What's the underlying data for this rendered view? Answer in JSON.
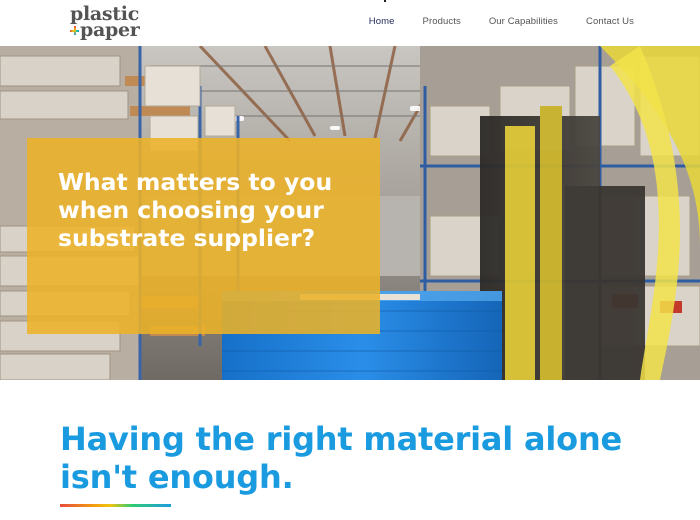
{
  "brand": {
    "line1": "plastic",
    "line2": "paper"
  },
  "nav": {
    "items": [
      {
        "label": "Home"
      },
      {
        "label": "Products"
      },
      {
        "label": "Our Capabilities"
      },
      {
        "label": "Contact Us"
      }
    ],
    "active": "Home"
  },
  "hero": {
    "title": "What matters to you when choosing your substrate supplier?",
    "overlay_color": "#ecb228",
    "image_subject": "warehouse-forklift"
  },
  "section": {
    "headline": "Having the right material alone isn't enough.",
    "headline_color": "#1a9be0"
  },
  "colors": {
    "nav_active": "#1f2a5a",
    "text_gray": "#555555",
    "accent_gradient": [
      "#e74c3c",
      "#f39c12",
      "#f1c40f",
      "#2ecc71",
      "#1e9be0"
    ]
  }
}
